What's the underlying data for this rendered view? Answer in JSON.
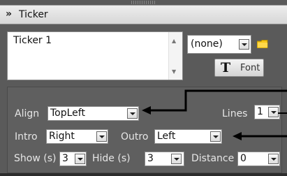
{
  "panel": {
    "title": "Ticker"
  },
  "ticker": {
    "text": "Ticker 1",
    "font_select": "(none)",
    "font_button": "Font"
  },
  "settings": {
    "align": {
      "label": "Align",
      "value": "TopLeft"
    },
    "lines": {
      "label": "Lines",
      "value": "1"
    },
    "intro": {
      "label": "Intro",
      "value": "Right"
    },
    "outro": {
      "label": "Outro",
      "value": "Left"
    },
    "show": {
      "label": "Show (s)",
      "value": "3"
    },
    "hide": {
      "label": "Hide (s)",
      "value": "3"
    },
    "distance": {
      "label": "Distance",
      "value": "0"
    }
  },
  "colors": {
    "panel_bg": "#5a5a5a",
    "header_bg": "#e4e4e4",
    "arrow": "#000000"
  }
}
